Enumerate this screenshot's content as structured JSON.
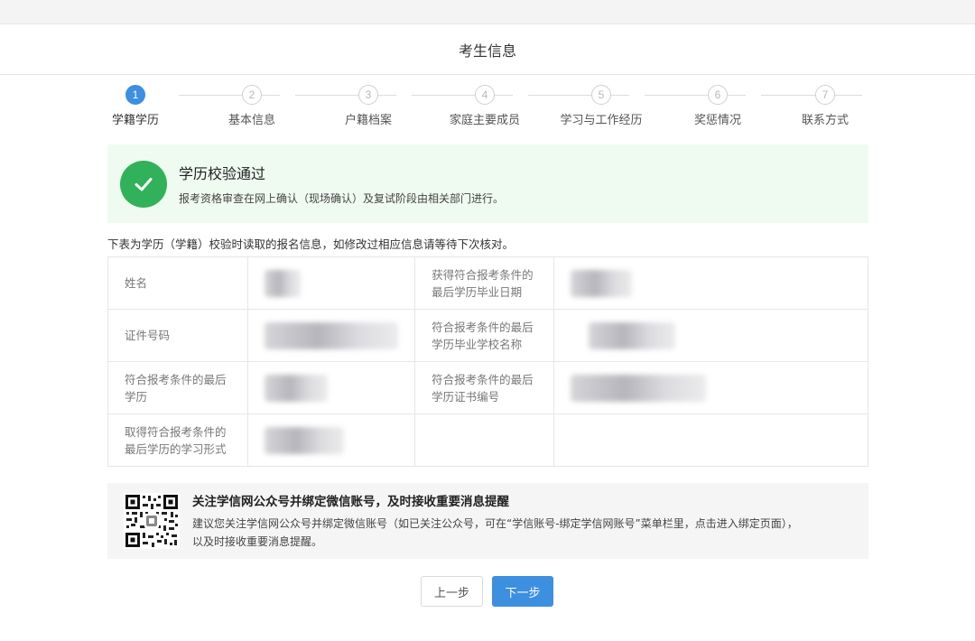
{
  "header": {
    "title": "考生信息"
  },
  "steps": [
    {
      "num": "1",
      "label": "学籍学历",
      "active": true
    },
    {
      "num": "2",
      "label": "基本信息",
      "active": false
    },
    {
      "num": "3",
      "label": "户籍档案",
      "active": false
    },
    {
      "num": "4",
      "label": "家庭主要成员",
      "active": false
    },
    {
      "num": "5",
      "label": "学习与工作经历",
      "active": false
    },
    {
      "num": "6",
      "label": "奖惩情况",
      "active": false
    },
    {
      "num": "7",
      "label": "联系方式",
      "active": false
    }
  ],
  "success": {
    "title": "学历校验通过",
    "desc": "报考资格审查在网上确认（现场确认）及复试阶段由相关部门进行。"
  },
  "note": "下表为学历（学籍）校验时读取的报名信息，如修改过相应信息请等待下次核对。",
  "table": {
    "rows": [
      {
        "label1": "姓名",
        "label2": "获得符合报考条件的最后学历毕业日期"
      },
      {
        "label1": "证件号码",
        "label2": "符合报考条件的最后学历毕业学校名称"
      },
      {
        "label1": "符合报考条件的最后学历",
        "label2": "符合报考条件的最后学历证书编号"
      },
      {
        "label1": "取得符合报考条件的最后学历的学习形式",
        "label2": ""
      }
    ]
  },
  "wechat": {
    "title": "关注学信网公众号并绑定微信账号，及时接收重要消息提醒",
    "desc1": "建议您关注学信网公众号并绑定微信账号（如已关注公众号，可在“学信账号-绑定学信网账号”菜单栏里，点击进入绑定页面），",
    "desc2": "以及时接收重要消息提醒。"
  },
  "buttons": {
    "prev": "上一步",
    "next": "下一步"
  },
  "colors": {
    "accent": "#3d8fe0",
    "success": "#30b15a",
    "success_bg": "#effbf1"
  }
}
